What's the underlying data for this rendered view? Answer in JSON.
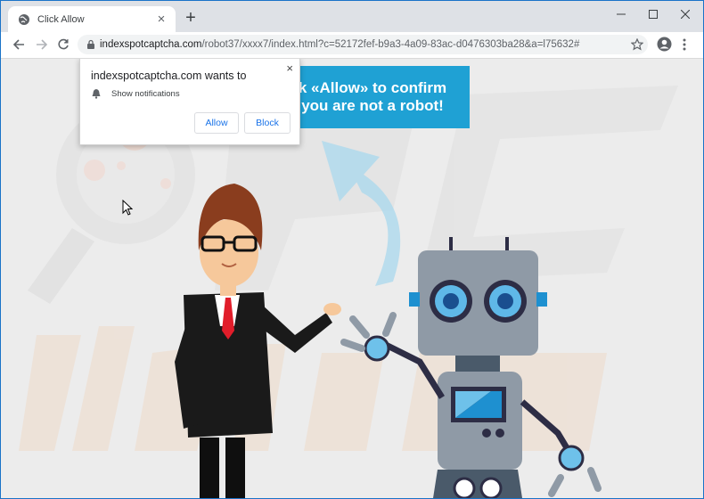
{
  "tab": {
    "title": "Click Allow",
    "close": "×"
  },
  "newtab": "+",
  "window_controls": {
    "minimize": "–",
    "maximize": "☐",
    "close": "✕"
  },
  "address_bar": {
    "host": "indexspotcaptcha.com",
    "path": "/robot37/xxxx7/index.html?c=52172fef-b9a3-4a09-83ac-d0476303ba28&a=l75632#"
  },
  "notification_prompt": {
    "title": "indexspotcaptcha.com wants to",
    "permission": "Show notifications",
    "allow_label": "Allow",
    "block_label": "Block",
    "close": "×"
  },
  "banner": {
    "line1": "k «Allow» to confirm",
    "line2": "you are not a robot!"
  },
  "colors": {
    "banner": "#1fa1d4",
    "arrow": "#a9d8ee",
    "button_text": "#1a73e8"
  }
}
